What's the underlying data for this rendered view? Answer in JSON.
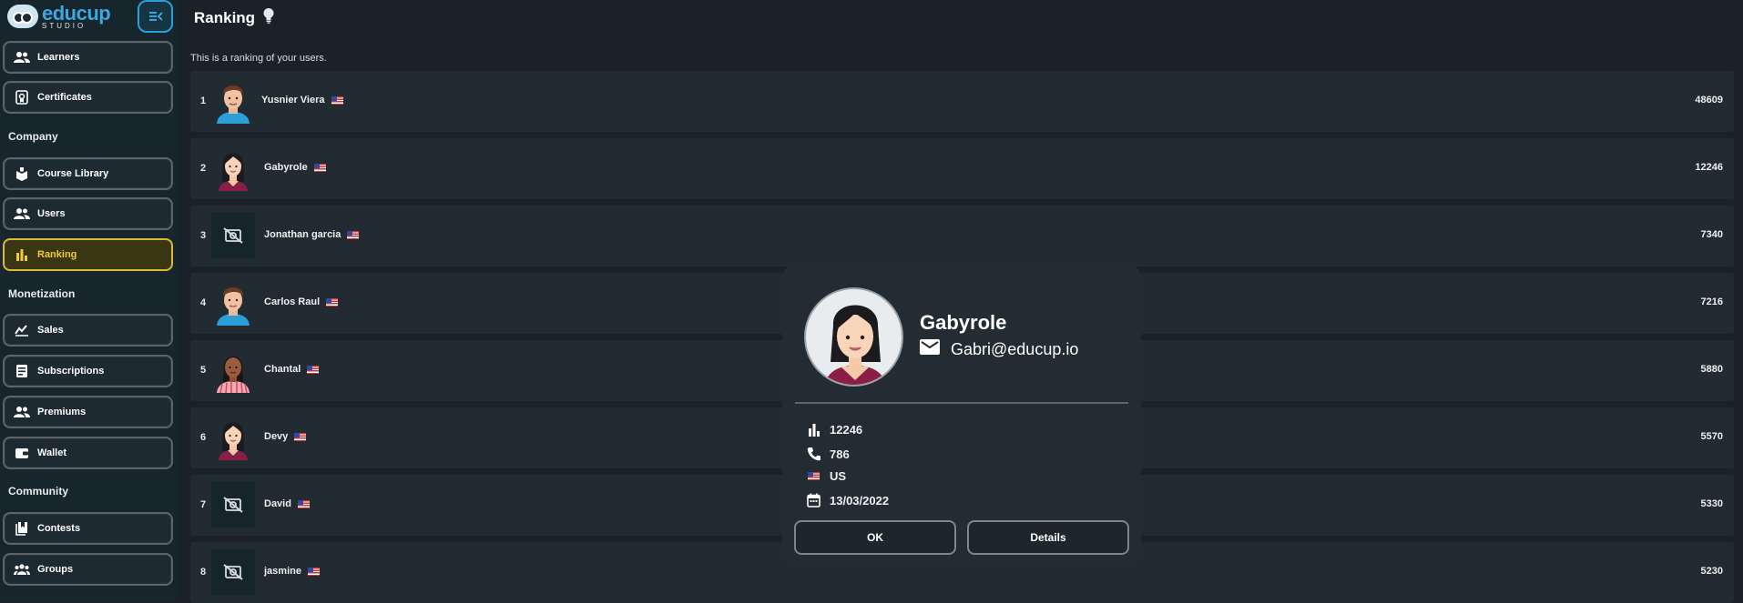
{
  "brand": {
    "name": "educup",
    "sub": "STUDIO"
  },
  "sidebar": {
    "items": [
      {
        "label": "Learners"
      },
      {
        "label": "Certificates"
      },
      {
        "label": "Course Library"
      },
      {
        "label": "Users"
      },
      {
        "label": "Ranking"
      },
      {
        "label": "Sales"
      },
      {
        "label": "Subscriptions"
      },
      {
        "label": "Premiums"
      },
      {
        "label": "Wallet"
      },
      {
        "label": "Contests"
      },
      {
        "label": "Groups"
      }
    ],
    "sections": [
      "Company",
      "Monetization",
      "Community"
    ],
    "active_color": "#f1c83a"
  },
  "page": {
    "title": "Ranking",
    "subtitle": "This is a ranking of your users."
  },
  "ranking": [
    {
      "rank": "1",
      "name": "Yusnier Viera",
      "score": "48609",
      "avatar": "man-avatar"
    },
    {
      "rank": "2",
      "name": "Gabyrole",
      "score": "12246",
      "avatar": "woman-avatar"
    },
    {
      "rank": "3",
      "name": "Jonathan garcia",
      "score": "7340",
      "avatar": "no-image-icon"
    },
    {
      "rank": "4",
      "name": "Carlos Raul",
      "score": "7216",
      "avatar": "man-avatar"
    },
    {
      "rank": "5",
      "name": "Chantal",
      "score": "5880",
      "avatar": "woman-dark-avatar"
    },
    {
      "rank": "6",
      "name": "Devy",
      "score": "5570",
      "avatar": "woman-avatar"
    },
    {
      "rank": "7",
      "name": "David",
      "score": "5330",
      "avatar": "no-image-icon"
    },
    {
      "rank": "8",
      "name": "jasmine",
      "score": "5230",
      "avatar": "no-image-icon"
    }
  ],
  "modal": {
    "name": "Gabyrole",
    "email": "Gabri@educup.io",
    "points": "12246",
    "phone": "786",
    "country": "US",
    "date": "13/03/2022",
    "ok_label": "OK",
    "details_label": "Details"
  }
}
